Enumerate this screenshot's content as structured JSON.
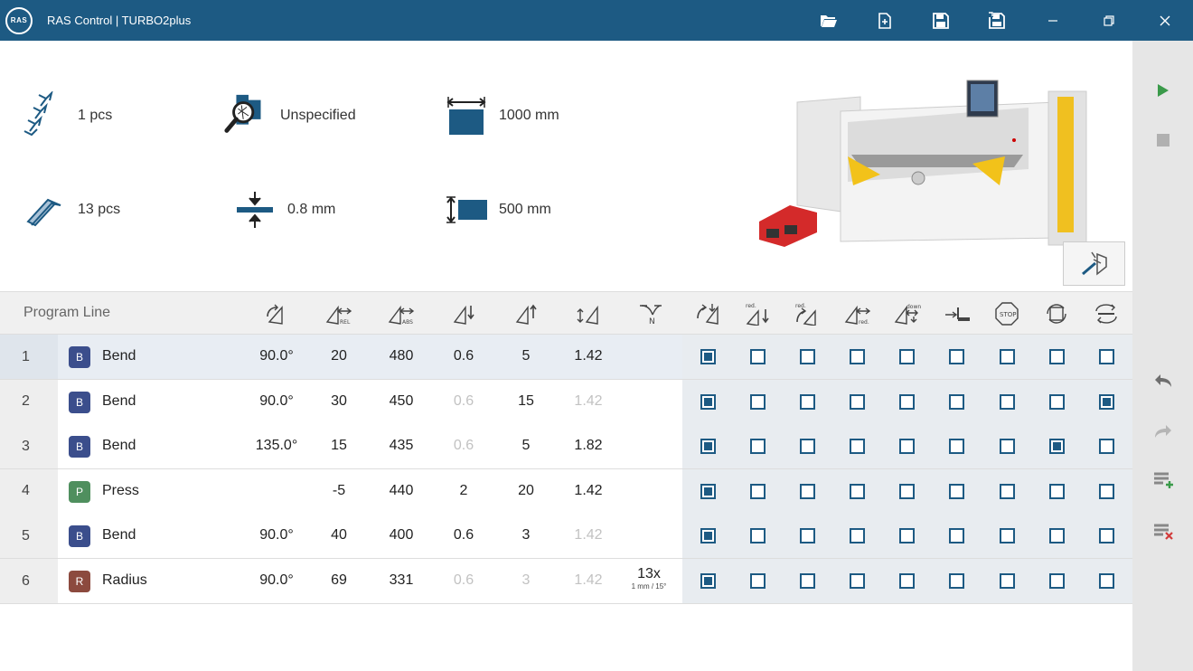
{
  "titlebar": {
    "logo_text": "RAS",
    "title": "RAS Control  |  TURBO2plus",
    "icons": [
      "folder-open-icon",
      "new-file-icon",
      "save-icon",
      "save-as-icon",
      "minimize-icon",
      "restore-icon",
      "close-icon"
    ]
  },
  "info": {
    "parts_count": "1 pcs",
    "material": "Unspecified",
    "width": "1000 mm",
    "bends_count": "13 pcs",
    "thickness": "0.8 mm",
    "depth": "500 mm"
  },
  "table": {
    "header_label": "Program Line",
    "value_columns": [
      "angle-icon",
      "backgauge-rel-icon",
      "backgauge-abs-icon",
      "clamp-down-icon",
      "clamp-up-icon",
      "springback-icon",
      "repeat-n-icon"
    ],
    "check_columns": [
      "flip-part-icon",
      "reduced-clamp-icon",
      "reduced-bend-icon",
      "reduced-gauge-icon",
      "down-gauge-icon",
      "stop-plate-icon",
      "stop-icon",
      "rotate-part-icon",
      "turn-part-icon"
    ],
    "rows": [
      {
        "num": "1",
        "badge": "B",
        "type": "Bend",
        "color": "#3b4e8c",
        "angle": "90.0°",
        "rel": "20",
        "abs": "480",
        "c1": "0.6",
        "c1dim": false,
        "c2": "5",
        "c2dim": false,
        "c3": "1.42",
        "c3dim": false,
        "rep": "",
        "rep_small": "",
        "checks": [
          1,
          0,
          0,
          0,
          0,
          0,
          0,
          0,
          0
        ]
      },
      {
        "num": "2",
        "badge": "B",
        "type": "Bend",
        "color": "#3b4e8c",
        "angle": "90.0°",
        "rel": "30",
        "abs": "450",
        "c1": "0.6",
        "c1dim": true,
        "c2": "15",
        "c2dim": false,
        "c3": "1.42",
        "c3dim": true,
        "rep": "",
        "rep_small": "",
        "checks": [
          1,
          0,
          0,
          0,
          0,
          0,
          0,
          0,
          1
        ]
      },
      {
        "num": "3",
        "badge": "B",
        "type": "Bend",
        "color": "#3b4e8c",
        "angle": "135.0°",
        "rel": "15",
        "abs": "435",
        "c1": "0.6",
        "c1dim": true,
        "c2": "5",
        "c2dim": false,
        "c3": "1.82",
        "c3dim": false,
        "rep": "",
        "rep_small": "",
        "checks": [
          1,
          0,
          0,
          0,
          0,
          0,
          0,
          1,
          0
        ]
      },
      {
        "num": "4",
        "badge": "P",
        "type": "Press",
        "color": "#4f8f5e",
        "angle": "",
        "rel": "-5",
        "abs": "440",
        "c1": "2",
        "c1dim": false,
        "c2": "20",
        "c2dim": false,
        "c3": "1.42",
        "c3dim": false,
        "rep": "",
        "rep_small": "",
        "checks": [
          1,
          0,
          0,
          0,
          0,
          0,
          0,
          0,
          0
        ]
      },
      {
        "num": "5",
        "badge": "B",
        "type": "Bend",
        "color": "#3b4e8c",
        "angle": "90.0°",
        "rel": "40",
        "abs": "400",
        "c1": "0.6",
        "c1dim": false,
        "c2": "3",
        "c2dim": false,
        "c3": "1.42",
        "c3dim": true,
        "rep": "",
        "rep_small": "",
        "checks": [
          1,
          0,
          0,
          0,
          0,
          0,
          0,
          0,
          0
        ]
      },
      {
        "num": "6",
        "badge": "R",
        "type": "Radius",
        "color": "#8c4a3e",
        "angle": "90.0°",
        "rel": "69",
        "abs": "331",
        "c1": "0.6",
        "c1dim": true,
        "c2": "3",
        "c2dim": true,
        "c3": "1.42",
        "c3dim": true,
        "rep": "13x",
        "rep_small": "1 mm / 15°",
        "checks": [
          1,
          0,
          0,
          0,
          0,
          0,
          0,
          0,
          0
        ]
      }
    ]
  },
  "sidebar": {
    "icons": [
      "play-icon",
      "stop-icon",
      "undo-icon",
      "redo-icon",
      "add-line-icon",
      "delete-line-icon"
    ]
  },
  "colors": {
    "titlebar": "#1d5a83",
    "accent": "#1d5a83",
    "play": "#3a9a4a",
    "delete": "#d23b3b"
  }
}
